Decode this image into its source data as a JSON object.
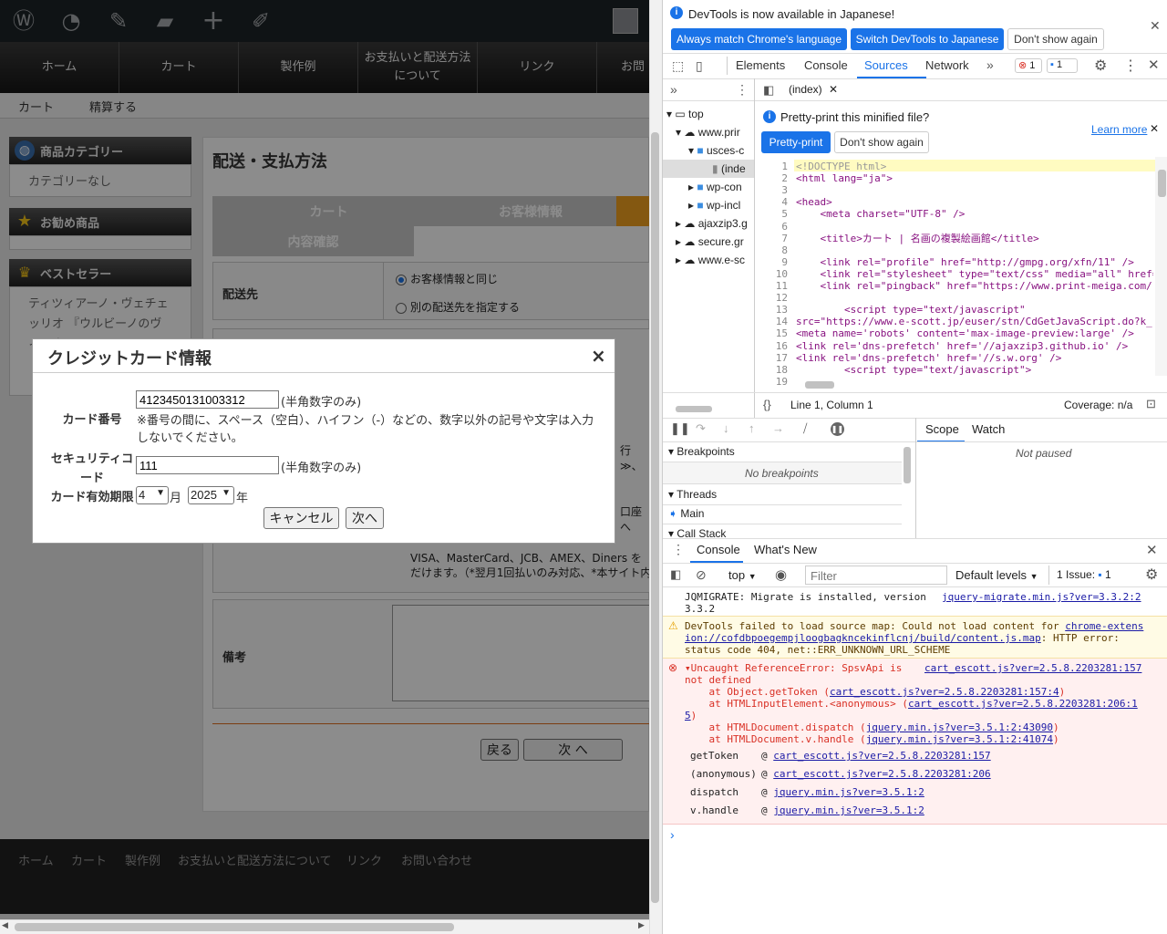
{
  "adminbar": {
    "icons": [
      "wordpress-icon",
      "dashboard-icon",
      "customize-icon",
      "comments-icon",
      "new-icon",
      "edit-icon"
    ]
  },
  "gnav": [
    "ホーム",
    "カート",
    "製作例",
    "お支払いと配送方法について",
    "リンク",
    "お問"
  ],
  "subnav": [
    "カート",
    "精算する"
  ],
  "sidebar": {
    "category_title": "商品カテゴリー",
    "category_body": "カテゴリーなし",
    "recommend_title": "お勧め商品",
    "bestseller_title": "ベストセラー",
    "bestseller_body": "ティツィアーノ・ヴェチェッリオ 『ウルビーノのヴィーナス』"
  },
  "main": {
    "title": "配送・支払方法",
    "steps": [
      "カート",
      "お客様情報",
      "内容確認"
    ],
    "shipping_label": "配送先",
    "ship_opt1": "お客様情報と同じ",
    "ship_opt2": "別の配送先を指定する",
    "partial1": "行≫、",
    "partial2": "口座へ",
    "pay_note1": "VISA、MasterCard、JCB、AMEX、Diners を",
    "pay_note2": "だけます。（*翌月1回払いのみ対応、*本サイト内",
    "memo_label": "備考",
    "back_btn": "戻る",
    "next_btn": "次 へ"
  },
  "footer": [
    "ホーム",
    "カート",
    "製作例",
    "お支払いと配送方法について",
    "リンク",
    "お問い合わせ"
  ],
  "modal": {
    "title": "クレジットカード情報",
    "close": "×",
    "card_label": "カード番号",
    "card_value": "4123450131003312",
    "halfwidth_note": "(半角数字のみ)",
    "card_note_1": "※番号の間に、スペース（空白）、ハイフン（-）などの、数字以外の記号や文字は入力",
    "card_note_2": "しないでください。",
    "cvc_label_1": "セキュリティコ",
    "cvc_label_2": "ード",
    "cvc_value": "111",
    "expiry_label": "カード有効期限",
    "month": "4",
    "month_unit": "月",
    "year": "2025",
    "year_unit": "年",
    "cancel": "キャンセル",
    "next": "次へ"
  },
  "devtools": {
    "infobar": "DevTools is now available in Japanese!",
    "btn_match": "Always match Chrome's language",
    "btn_switch": "Switch DevTools to Japanese",
    "btn_dont": "Don't show again",
    "tabs": [
      "Elements",
      "Console",
      "Sources",
      "Network"
    ],
    "active_tab": "Sources",
    "errors": "1",
    "messages": "1",
    "file_tab": "(index)",
    "tree": [
      "top",
      "www.prir",
      "usces-c",
      "(inde",
      "wp-con",
      "wp-incl",
      "ajaxzip3.g",
      "secure.gr",
      "www.e-sc"
    ],
    "pretty_prompt": "Pretty-print this minified file?",
    "learn_more": "Learn more",
    "pretty_btn": "Pretty-print",
    "dont_show": "Don't show again",
    "code_lines": [
      "<!DOCTYPE html>",
      "<html lang=\"ja\">",
      "",
      "<head>",
      "    <meta charset=\"UTF-8\" />",
      "",
      "    <title>カート | 名画の複製絵画館</title>",
      "",
      "    <link rel=\"profile\" href=\"http://gmpg.org/xfn/11\" />",
      "    <link rel=\"stylesheet\" type=\"text/css\" media=\"all\" href=",
      "    <link rel=\"pingback\" href=\"https://www.print-meiga.com/",
      "",
      "        <script type=\"text/javascript\"",
      "src=\"https://www.e-scott.jp/euser/stn/CdGetJavaScript.do?k_",
      "<meta name='robots' content='max-image-preview:large' />",
      "<link rel='dns-prefetch' href='//ajaxzip3.github.io' />",
      "<link rel='dns-prefetch' href='//s.w.org' />",
      "        <script type=\"text/javascript\">",
      ""
    ],
    "status_pos": "Line 1, Column 1",
    "coverage": "Coverage: n/a",
    "breakpoints": "Breakpoints",
    "no_breakpoints": "No breakpoints",
    "threads": "Threads",
    "main_thread": "Main",
    "call_stack": "Call Stack",
    "scope": "Scope",
    "watch": "Watch",
    "not_paused": "Not paused",
    "drawer_tabs": [
      "Console",
      "What's New"
    ],
    "context": "top",
    "filter_placeholder": "Filter",
    "levels": "Default levels",
    "issues": "1 Issue:",
    "issues_count": "1",
    "console": {
      "msg1": "JQMIGRATE: Migrate is installed, version",
      "msg1_ver": "3.3.2",
      "msg1_src": "jquery-migrate.min.js?ver=3.3.2:2",
      "warn_1": "DevTools failed to load source map: Could not load content for",
      "warn_link1": "chrome-extens",
      "warn_link2": "ion://cofdbpoegempjloogbagkncekinflcnj/build/content.js.map",
      "warn_3": ": HTTP error:",
      "warn_4": "status code 404, net::ERR_UNKNOWN_URL_SCHEME",
      "err_1": "Uncaught ReferenceError: SpsvApi is",
      "err_src": "cart_escott.js?ver=2.5.8.2203281:157",
      "err_2": "not defined",
      "st1": "    at Object.getToken (",
      "st1_l": "cart_escott.js?ver=2.5.8.2203281:157:4",
      "st2": "    at HTMLInputElement.<anonymous> (",
      "st2_l": "cart_escott.js?ver=2.5.8.2203281:206:1",
      "st2_l2": "5",
      "st3": "    at HTMLDocument.dispatch (",
      "st3_l": "jquery.min.js?ver=3.5.1:2:43090",
      "st4": "    at HTMLDocument.v.handle (",
      "st4_l": "jquery.min.js?ver=3.5.1:2:41074",
      "f1": "getToken",
      "f1_l": "cart_escott.js?ver=2.5.8.2203281:157",
      "f2": "(anonymous)",
      "f2_l": "cart_escott.js?ver=2.5.8.2203281:206",
      "f3": "dispatch",
      "f3_l": "jquery.min.js?ver=3.5.1:2",
      "f4": "v.handle",
      "f4_l": "jquery.min.js?ver=3.5.1:2"
    }
  }
}
